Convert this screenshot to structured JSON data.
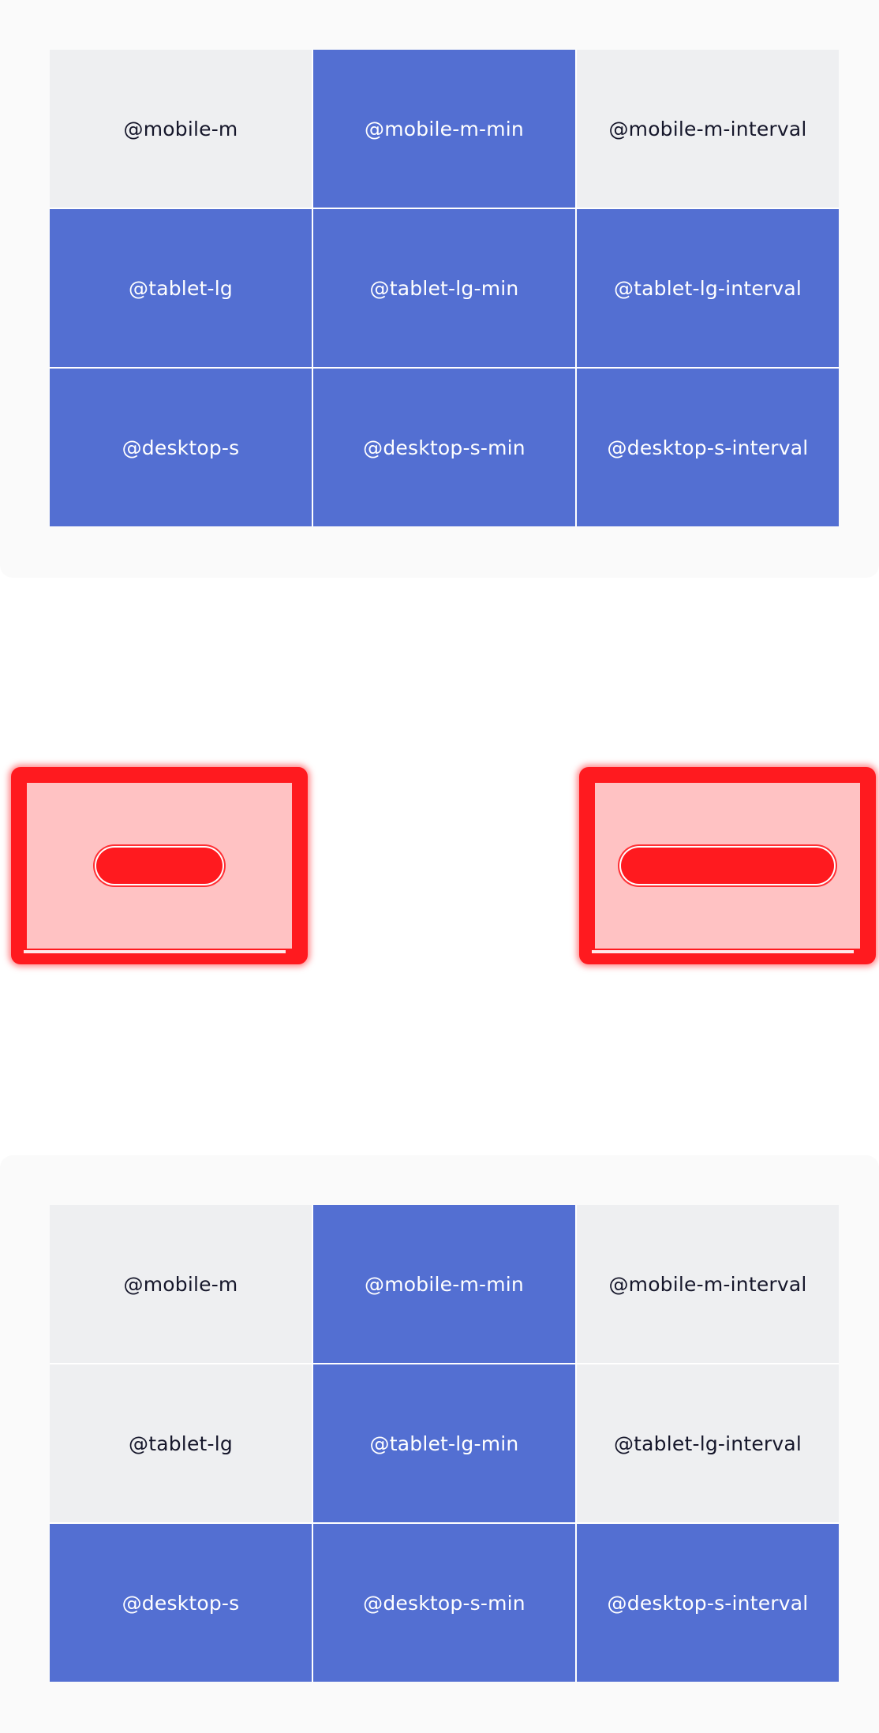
{
  "top_grid": {
    "rows": [
      [
        {
          "label": "@mobile-m",
          "active": false
        },
        {
          "label": "@mobile-m-min",
          "active": true
        },
        {
          "label": "@mobile-m-interval",
          "active": false
        }
      ],
      [
        {
          "label": "@tablet-lg",
          "active": true
        },
        {
          "label": "@tablet-lg-min",
          "active": true
        },
        {
          "label": "@tablet-lg-interval",
          "active": true
        }
      ],
      [
        {
          "label": "@desktop-s",
          "active": true
        },
        {
          "label": "@desktop-s-min",
          "active": true
        },
        {
          "label": "@desktop-s-interval",
          "active": true
        }
      ]
    ]
  },
  "bottom_grid": {
    "rows": [
      [
        {
          "label": "@mobile-m",
          "active": false
        },
        {
          "label": "@mobile-m-min",
          "active": true
        },
        {
          "label": "@mobile-m-interval",
          "active": false
        }
      ],
      [
        {
          "label": "@tablet-lg",
          "active": false
        },
        {
          "label": "@tablet-lg-min",
          "active": true
        },
        {
          "label": "@tablet-lg-interval",
          "active": false
        }
      ],
      [
        {
          "label": "@desktop-s",
          "active": true
        },
        {
          "label": "@desktop-s-min",
          "active": true
        },
        {
          "label": "@desktop-s-interval",
          "active": true
        }
      ]
    ]
  },
  "colors": {
    "active_cell": "#536fd2",
    "inactive_cell": "#eeeff1",
    "active_text": "#ffffff",
    "inactive_text": "#15162a",
    "glitch_border": "#ff1a1f",
    "glitch_fill": "#ffc2c3"
  }
}
